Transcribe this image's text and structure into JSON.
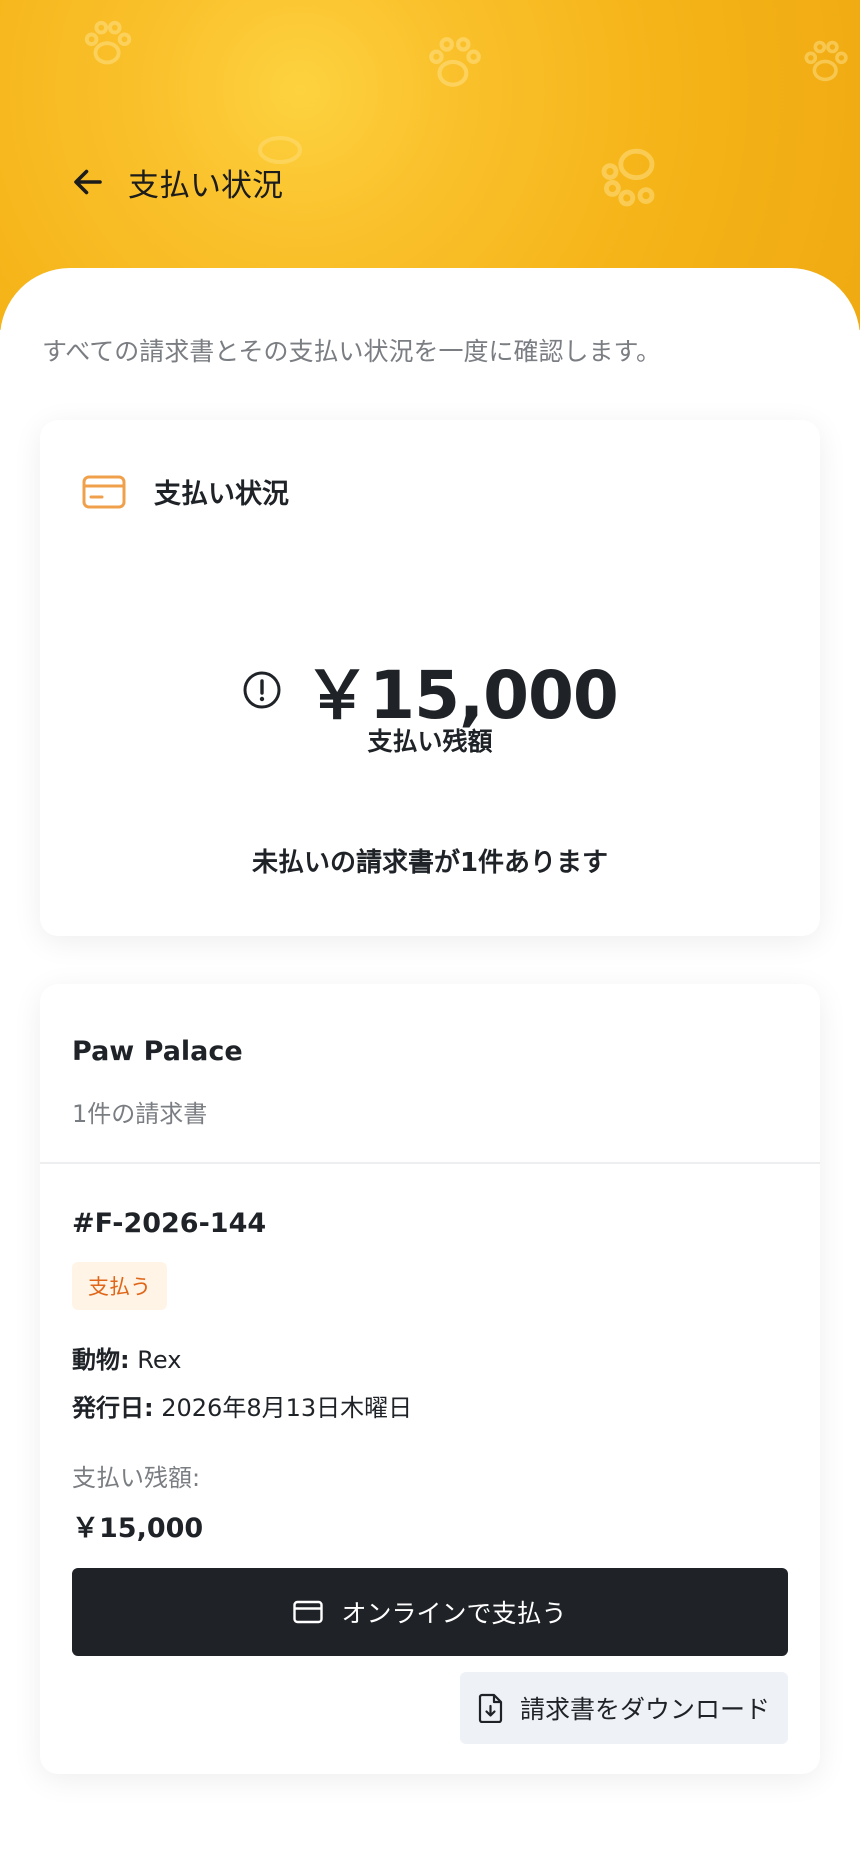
{
  "header": {
    "title": "支払い状況",
    "back_icon": "arrow-left-icon",
    "background_color": "#f5b418"
  },
  "intro": "すべての請求書とその支払い状況を一度に確認します。",
  "summary": {
    "title": "支払い状況",
    "icon": "credit-card-icon",
    "icon_color": "#f0a04b",
    "amount": "￥15,000",
    "amount_icon": "alert-circle-icon",
    "amount_label": "支払い残額",
    "message": "未払いの請求書が1件あります"
  },
  "clinic": {
    "name": "Paw Palace",
    "invoice_count": "1件の請求書",
    "invoice": {
      "number": "#F-2026-144",
      "status": "支払う",
      "status_color": "#e0661a",
      "animal_label": "動物:",
      "animal": "Rex",
      "issued_label": "発行日:",
      "issued": "2026年8月13日木曜日",
      "remaining_label": "支払い残額:",
      "remaining_value": "￥15,000",
      "pay_button": "オンラインで支払う",
      "download_button": "請求書をダウンロード"
    }
  }
}
